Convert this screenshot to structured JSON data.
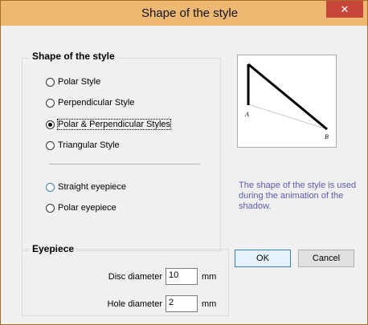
{
  "window": {
    "title": "Shape of the style",
    "close_glyph": "✕"
  },
  "shape_group": {
    "title": "Shape of the style",
    "options": [
      {
        "label": "Polar Style",
        "checked": false
      },
      {
        "label": "Perpendicular Style",
        "checked": false
      },
      {
        "label": "Polar & Perpendicular Styles",
        "checked": true
      },
      {
        "label": "Triangular Style",
        "checked": false
      }
    ],
    "eyepiece_options": [
      {
        "label": "Straight eyepiece",
        "checked": false
      },
      {
        "label": "Polar eyepiece",
        "checked": false
      }
    ]
  },
  "preview": {
    "label_a": "A",
    "label_b": "B"
  },
  "info_text": "The shape of the style is used during the animation of the shadow.",
  "eyepiece_group": {
    "title": "Eyepiece",
    "disc_label": "Disc diameter",
    "disc_value": "10",
    "disc_unit": "mm",
    "hole_label": "Hole diameter",
    "hole_value": "2",
    "hole_unit": "mm"
  },
  "buttons": {
    "ok": "OK",
    "cancel": "Cancel"
  }
}
